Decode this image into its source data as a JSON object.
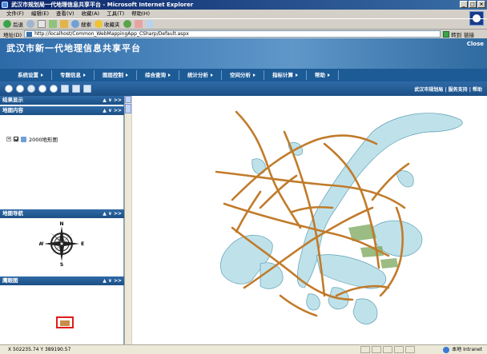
{
  "browser": {
    "title": "武汉市规划局一代地理信息共享平台 - Microsoft Internet Explorer",
    "menu": [
      "文件(F)",
      "编辑(E)",
      "查看(V)",
      "收藏(A)",
      "工具(T)",
      "帮助(H)"
    ],
    "toolbar": {
      "back": "后退",
      "search": "搜索",
      "favorites": "收藏夹"
    },
    "address_label": "地址(D)",
    "address_value": "http://localhost/Common_WebMappingApp_CSharp/Default.aspx",
    "go_label": "转到",
    "links_label": "链接"
  },
  "banner": {
    "title": "武汉市新一代地理信息共享平台",
    "login": "Close"
  },
  "nav": [
    "系统设置",
    "专题信息",
    "图层控制",
    "综合查询",
    "统计分析",
    "空间分析",
    "指标计算",
    "帮助"
  ],
  "mapbar_links": "武汉市规划局 | 服务支持 | 帮助",
  "panels": {
    "results": {
      "title": "结果显示",
      "ctl": "▲ ∨ >>"
    },
    "layers": {
      "title": "地图内容",
      "ctl": "▲ ∨ >>",
      "layer_name": "2000地形图"
    },
    "nav": {
      "title": "地图导航",
      "ctl": "▲ ∨ >>"
    },
    "overview": {
      "title": "鹰眼图",
      "ctl": "▲ ∨ >>"
    }
  },
  "compass": {
    "n": "N",
    "s": "S",
    "e": "E",
    "w": "W"
  },
  "status": {
    "coords": "X 502235.74   Y 389190.57",
    "zone": "本地 Intranet"
  },
  "colors": {
    "road": "#c17b2b",
    "water": "#bfe2ea",
    "water_edge": "#5a9fb2",
    "green": "#7aa55a"
  }
}
